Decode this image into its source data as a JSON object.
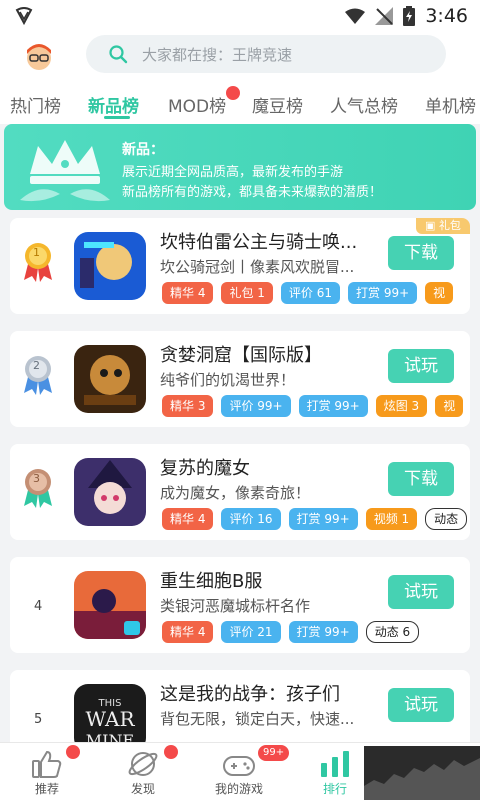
{
  "status_bar": {
    "time": "3:46"
  },
  "search": {
    "placeholder": "大家都在搜：王牌竞速"
  },
  "tabs": [
    {
      "label": "热门榜"
    },
    {
      "label": "新品榜"
    },
    {
      "label": "MOD榜"
    },
    {
      "label": "魔豆榜"
    },
    {
      "label": "人气总榜"
    },
    {
      "label": "单机榜"
    }
  ],
  "banner": {
    "title": "新品：",
    "line1": "展示近期全网品质高，最新发布的手游",
    "line2": "新品榜所有的游戏，都具备未来爆款的潜质！"
  },
  "games": [
    {
      "rank": "1",
      "title": "坎特伯雷公主与骑士唤...",
      "desc": "坎公骑冠剑丨像素风欢脱冒...",
      "button": "下载",
      "gift": "礼包",
      "tags": [
        {
          "text": "精华 4",
          "style": "red"
        },
        {
          "text": "礼包 1",
          "style": "red"
        },
        {
          "text": "评价 61",
          "style": "blue"
        },
        {
          "text": "打赏 99+",
          "style": "blue"
        },
        {
          "text": "视",
          "style": "orange"
        }
      ]
    },
    {
      "rank": "2",
      "title": "贪婪洞窟【国际版】",
      "desc": "纯爷们的饥渴世界！",
      "button": "试玩",
      "tags": [
        {
          "text": "精华 3",
          "style": "red"
        },
        {
          "text": "评价 99+",
          "style": "blue"
        },
        {
          "text": "打赏 99+",
          "style": "blue"
        },
        {
          "text": "炫图 3",
          "style": "orange"
        },
        {
          "text": "视",
          "style": "orange"
        }
      ]
    },
    {
      "rank": "3",
      "title": "复苏的魔女",
      "desc": "成为魔女，像素奇旅！",
      "button": "下载",
      "tags": [
        {
          "text": "精华 4",
          "style": "red"
        },
        {
          "text": "评价 16",
          "style": "blue"
        },
        {
          "text": "打赏 99+",
          "style": "blue"
        },
        {
          "text": "视频 1",
          "style": "orange"
        },
        {
          "text": "动态",
          "style": "outline"
        }
      ]
    },
    {
      "rank": "4",
      "title": "重生细胞B服",
      "desc": "类银河恶魔城标杆名作",
      "button": "试玩",
      "tags": [
        {
          "text": "精华 4",
          "style": "red"
        },
        {
          "text": "评价 21",
          "style": "blue"
        },
        {
          "text": "打赏 99+",
          "style": "blue"
        },
        {
          "text": "动态 6",
          "style": "outline"
        }
      ]
    },
    {
      "rank": "5",
      "title": "这是我的战争：孩子们",
      "desc": "背包无限，锁定白天，快速...",
      "button": "试玩",
      "tags": []
    }
  ],
  "bottom_nav": [
    {
      "label": "推荐"
    },
    {
      "label": "发现"
    },
    {
      "label": "我的游戏",
      "badge": "99+"
    },
    {
      "label": "排行"
    }
  ],
  "colors": {
    "accent": "#2fc7a2",
    "button": "#46d2b3",
    "red": "#f26446",
    "blue": "#4ab3ef",
    "orange": "#f79a1b"
  }
}
